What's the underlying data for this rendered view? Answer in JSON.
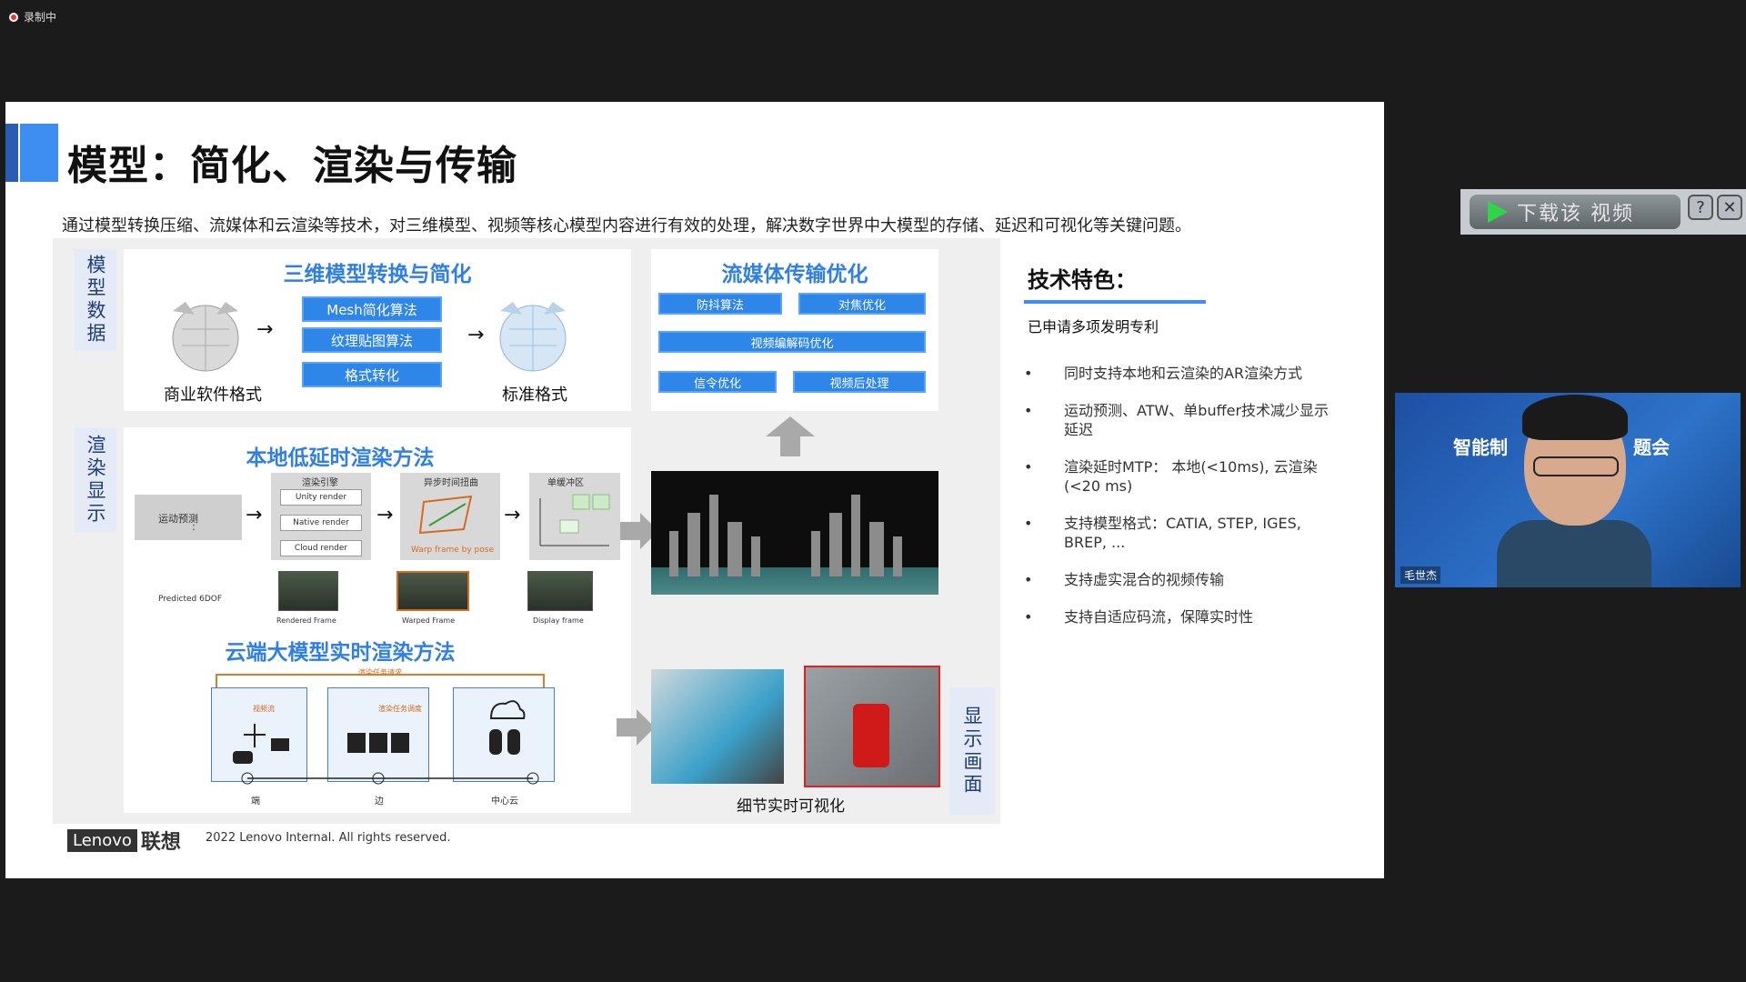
{
  "recording": {
    "label": "录制中"
  },
  "slide": {
    "title": "模型：简化、渲染与传输",
    "subtitle": "通过模型转换压缩、流媒体和云渲染等技术，对三维模型、视频等核心模型内容进行有效的处理，解决数字世界中大模型的存储、延迟和可视化等关键问题。",
    "model_data": {
      "label": "模型数据",
      "title": "三维模型转换与简化",
      "steps": [
        "Mesh简化算法",
        "纹理贴图算法",
        "格式转化"
      ],
      "left_caption": "商业软件格式",
      "right_caption": "标准格式"
    },
    "streaming": {
      "title": "流媒体传输优化",
      "buttons": [
        "防抖算法",
        "对焦优化",
        "视频编解码优化",
        "信令优化",
        "视频后处理"
      ]
    },
    "render_display": {
      "label": "渲染显示",
      "local_title": "本地低延时渲染方法",
      "motion": "运动预测",
      "engine_title": "渲染引擎",
      "engine_items": [
        "Unity render",
        "Native render",
        "Cloud render"
      ],
      "async_title": "异步时间扭曲",
      "async_note": "Warp frame by pose",
      "buffer_title": "单缓冲区",
      "predicted": "Predicted 6DOF",
      "frames": [
        "Rendered Frame",
        "Warped Frame",
        "Display frame"
      ],
      "cloud_title": "云端大模型实时渲染方法",
      "cloud_top_note": "渲染任务请求",
      "cloud_note1": "视频流",
      "cloud_note2": "渲染任务调度",
      "cloud_nodes": [
        "端",
        "边",
        "中心云"
      ]
    },
    "detail_caption": "细节实时可视化",
    "display_label": "显示画面",
    "features": {
      "title": "技术特色：",
      "subtitle": "已申请多项发明专利",
      "items": [
        "同时支持本地和云渲染的AR渲染方式",
        "运动预测、ATW、单buffer技术减少显示延迟",
        "渲染延时MTP： 本地(<10ms), 云渲染(<20 ms)",
        "支持模型格式：CATIA, STEP, IGES, BREP, ...",
        "支持虚实混合的视频传输",
        "支持自适应码流，保障实时性"
      ]
    },
    "footer": {
      "logo": "Lenovo",
      "logo_cn": "联想",
      "text": "2022 Lenovo Internal. All rights reserved."
    }
  },
  "download": {
    "label": "下载该 视频",
    "help": "?",
    "close": "✕"
  },
  "camera": {
    "banner_left": "智能制",
    "banner_right": "题会",
    "name": "毛世杰"
  }
}
